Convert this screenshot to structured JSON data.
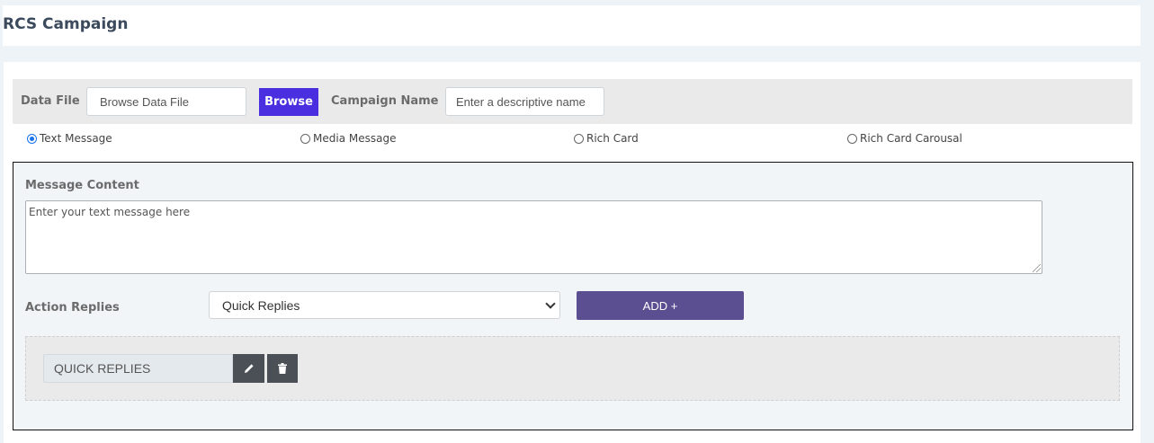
{
  "header": {
    "title": "RCS Campaign"
  },
  "file_bar": {
    "data_file_label": "Data File",
    "data_file_placeholder": "Browse Data File",
    "browse_label": "Browse",
    "campaign_name_label": "Campaign Name",
    "campaign_name_placeholder": "Enter a descriptive name"
  },
  "message_types": [
    {
      "label": "Text Message",
      "selected": true
    },
    {
      "label": "Media Message",
      "selected": false
    },
    {
      "label": "Rich Card",
      "selected": false
    },
    {
      "label": "Rich Card Carousal",
      "selected": false
    }
  ],
  "message": {
    "content_label": "Message Content",
    "placeholder": "Enter your text message here"
  },
  "actions": {
    "label": "Action Replies",
    "selected_option": "Quick Replies",
    "add_label": "ADD +"
  },
  "replies": [
    {
      "label": "QUICK REPLIES",
      "edit_icon": "pencil-icon",
      "delete_icon": "trash-icon"
    }
  ],
  "colors": {
    "browse_button": "#4a2fe0",
    "add_button": "#5b4f91",
    "icon_button": "#4a5056",
    "radio_selected": "#1a73e8"
  }
}
